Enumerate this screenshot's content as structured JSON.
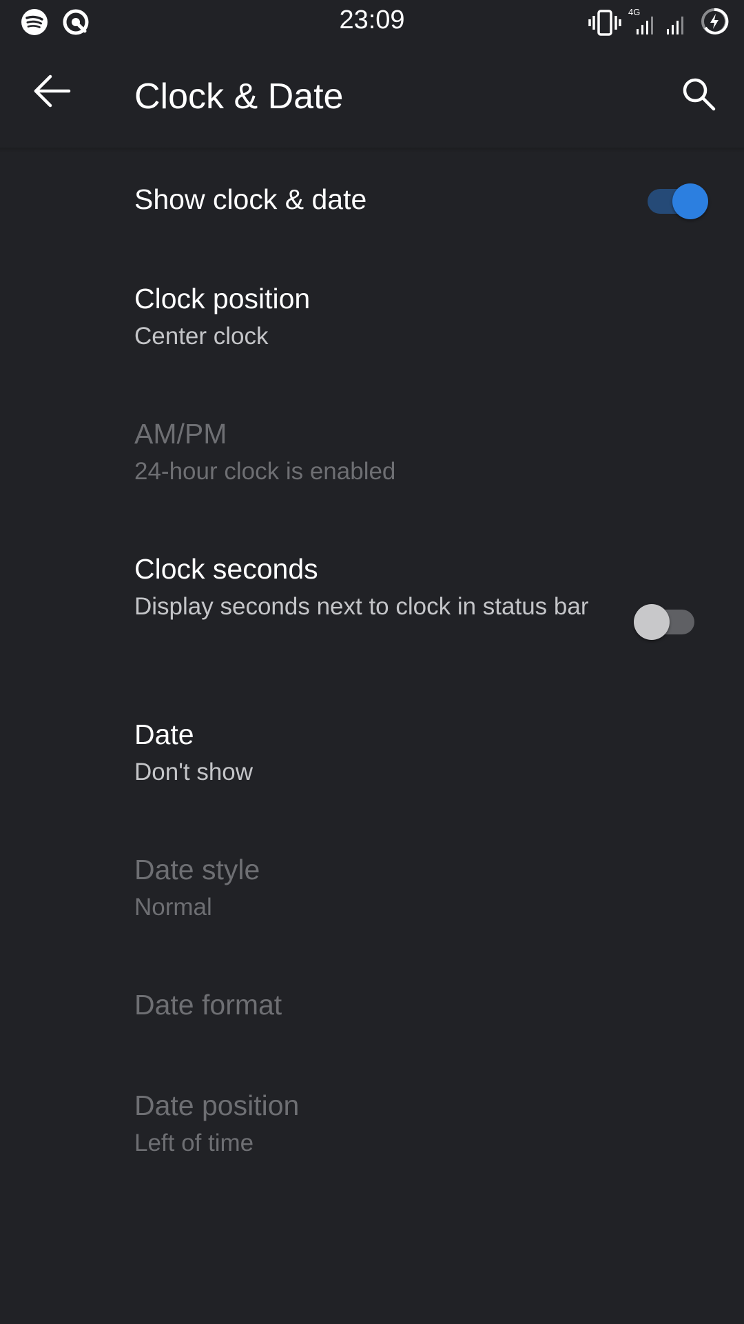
{
  "status_bar": {
    "time": "23:09",
    "network_label": "4G",
    "left_icons": [
      "spotify-icon",
      "q-notification-icon"
    ],
    "right_icons": [
      "vibrate-icon",
      "signal-4g-icon",
      "signal-icon",
      "battery-charging-icon"
    ]
  },
  "app_bar": {
    "title": "Clock & Date",
    "back_icon": "arrow-back-icon",
    "search_icon": "search-icon"
  },
  "preferences": {
    "show_clock_date": {
      "title": "Show clock & date",
      "enabled": true,
      "checked": true
    },
    "clock_position": {
      "title": "Clock position",
      "summary": "Center clock",
      "enabled": true
    },
    "am_pm": {
      "title": "AM/PM",
      "summary": "24-hour clock is enabled",
      "enabled": false
    },
    "clock_seconds": {
      "title": "Clock seconds",
      "summary": "Display seconds next to clock in status bar",
      "enabled": true,
      "checked": false
    },
    "date": {
      "title": "Date",
      "summary": "Don't show",
      "enabled": true
    },
    "date_style": {
      "title": "Date style",
      "summary": "Normal",
      "enabled": false
    },
    "date_format": {
      "title": "Date format",
      "enabled": false
    },
    "date_position": {
      "title": "Date position",
      "summary": "Left of time",
      "enabled": false
    }
  },
  "colors": {
    "background": "#212226",
    "accent": "#2c7fe0",
    "text_primary": "#ffffff",
    "text_secondary": "#c4c5c8",
    "text_disabled": "#6e6f73"
  }
}
